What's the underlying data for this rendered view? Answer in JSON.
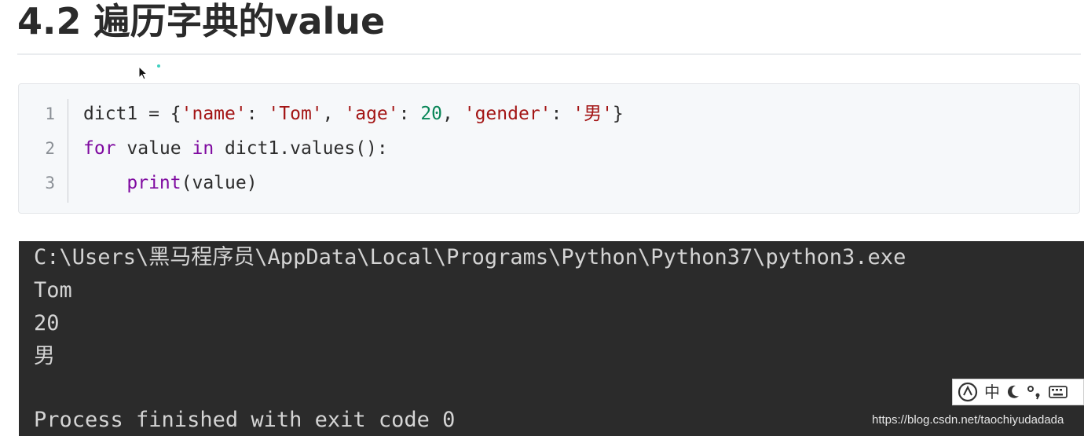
{
  "heading": {
    "title": "4.2 遍历字典的value"
  },
  "code_block": {
    "line_numbers": [
      "1",
      "2",
      "3"
    ],
    "line1": {
      "var": "dict1 = {",
      "k1": "'name'",
      "sep1": ": ",
      "v1": "'Tom'",
      "c1": ", ",
      "k2": "'age'",
      "sep2": ": ",
      "v2": "20",
      "c2": ", ",
      "k3": "'gender'",
      "sep3": ": ",
      "v3": "'男'",
      "end": "}"
    },
    "line2": {
      "kw_for": "for",
      "mid": " value ",
      "kw_in": "in",
      "rest": " dict1.values():"
    },
    "line3": {
      "indent": "    ",
      "fn": "print",
      "rest": "(value)"
    }
  },
  "console": {
    "path_line": "C:\\Users\\黑马程序员\\AppData\\Local\\Programs\\Python\\Python37\\python3.exe",
    "output": [
      "Tom",
      "20",
      "男"
    ],
    "exit_line": "Process finished with exit code 0"
  },
  "ime_toolbar": {
    "mode_label": "中",
    "icons": [
      "ime-logo-icon",
      "moon-icon",
      "punctuation-icon",
      "keyboard-icon"
    ]
  },
  "watermark": "https://blog.csdn.net/taochiyudadada",
  "colors": {
    "string": "#a31515",
    "number": "#098658",
    "keyword": "#7f0aa0",
    "console_bg": "#2b2b2b",
    "console_text": "#d4d4d4"
  }
}
